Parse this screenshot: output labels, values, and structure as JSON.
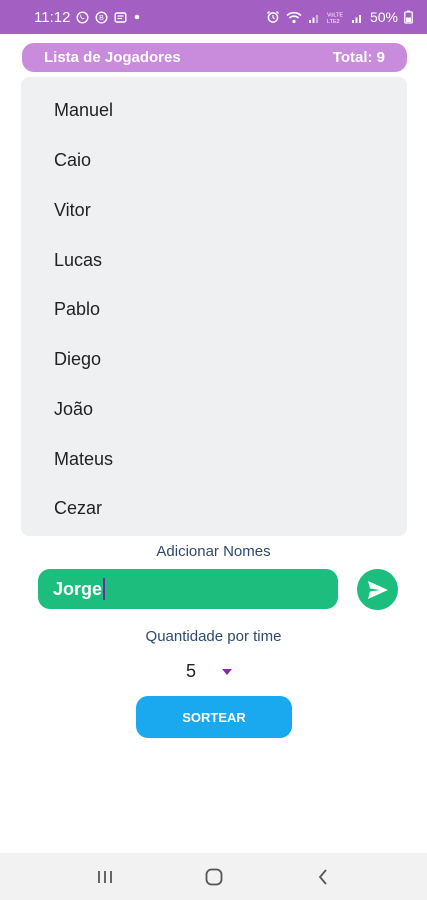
{
  "status_bar": {
    "time": "11:12",
    "battery": "50%",
    "icons_left": [
      "whatsapp-icon",
      "notification-icon",
      "message-icon",
      "dot-icon"
    ],
    "icons_right": [
      "alarm-icon",
      "wifi-icon",
      "signal-icon",
      "volte-icon",
      "signal-icon",
      "battery-icon"
    ]
  },
  "header": {
    "title": "Lista de Jogadores",
    "total": "Total: 9"
  },
  "players": [
    "Manuel",
    "Caio",
    "Vitor",
    "Lucas",
    "Pablo",
    "Diego",
    "João",
    "Mateus",
    "Cezar"
  ],
  "add_section": {
    "title": "Adicionar Nomes",
    "input_value": "Jorge",
    "send_icon": "send-icon"
  },
  "team_size": {
    "label": "Quantidade por time",
    "selected": "5"
  },
  "draw_button": "SORTEAR",
  "colors": {
    "status_bar": "#a35fc1",
    "header": "#c98bdb",
    "green": "#1cbd7d",
    "blue": "#1aa9ef",
    "label_text": "#2d4a6b"
  },
  "nav_bar": {
    "icons": [
      "recents-icon",
      "home-icon",
      "back-icon"
    ]
  }
}
